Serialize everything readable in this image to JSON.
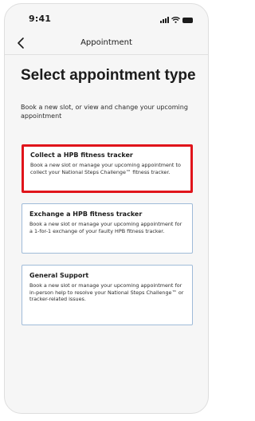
{
  "status_bar": {
    "time": "9:41"
  },
  "nav": {
    "title": "Appointment",
    "back_icon": "chevron-left-icon"
  },
  "page": {
    "title": "Select appointment type",
    "subtitle": "Book a new slot, or view and change your upcoming appointment"
  },
  "options": [
    {
      "title": "Collect a HPB fitness tracker",
      "description": "Book a new slot or manage your upcoming appointment to collect your National Steps Challenge™ fitness tracker.",
      "selected": true
    },
    {
      "title": "Exchange a HPB fitness tracker",
      "description": "Book a new slot or manage your upcoming appointment for a 1-for-1 exchange of your faulty HPB fitness tracker.",
      "selected": false
    },
    {
      "title": "General Support",
      "description": "Book a new slot or manage your upcoming appointment for in-person help to resolve your National Steps Challenge™ or tracker-related issues.",
      "selected": false
    }
  ],
  "colors": {
    "selected_border": "#e0141b",
    "card_border": "#9fbbd8",
    "background": "#f6f6f6",
    "text": "#1b1b1b"
  }
}
